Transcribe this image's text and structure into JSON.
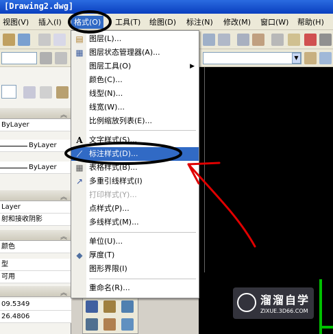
{
  "window": {
    "title": "[Drawing2.dwg]"
  },
  "menubar": {
    "items": [
      {
        "label": "视图(V)"
      },
      {
        "label": "插入(I)"
      },
      {
        "label": "格式(O)"
      },
      {
        "label": "工具(T)"
      },
      {
        "label": "绘图(D)"
      },
      {
        "label": "标注(N)"
      },
      {
        "label": "修改(M)"
      },
      {
        "label": "窗口(W)"
      },
      {
        "label": "帮助(H)"
      }
    ]
  },
  "left_panel": {
    "rows": [
      "ByLayer",
      "ByLayer",
      "ByLayer",
      "Layer",
      "射和接收阴影",
      "颜色",
      "型",
      "可用",
      "09.5349",
      "26.4806"
    ]
  },
  "format_menu": {
    "items": [
      {
        "label": "图层(L)..."
      },
      {
        "label": "图层状态管理器(A)..."
      },
      {
        "label": "图层工具(O)"
      },
      {
        "label": "颜色(C)..."
      },
      {
        "label": "线型(N)..."
      },
      {
        "label": "线宽(W)..."
      },
      {
        "label": "比例缩放列表(E)..."
      },
      {
        "label": "文字样式(S)..."
      },
      {
        "label": "标注样式(D)..."
      },
      {
        "label": "表格样式(B)..."
      },
      {
        "label": "多重引线样式(I)"
      },
      {
        "label": "打印样式(Y)..."
      },
      {
        "label": "点样式(P)..."
      },
      {
        "label": "多线样式(M)..."
      },
      {
        "label": "单位(U)..."
      },
      {
        "label": "厚度(T)"
      },
      {
        "label": "图形界限(I)"
      },
      {
        "label": "重命名(R)..."
      }
    ],
    "highlighted": "标注样式(D)..."
  },
  "watermark": {
    "title": "溜溜自学",
    "url": "ZIXUE.3D66.COM"
  },
  "colors": {
    "highlight": "#316ac5",
    "annotation": "#e00000",
    "circle": "#000000"
  }
}
